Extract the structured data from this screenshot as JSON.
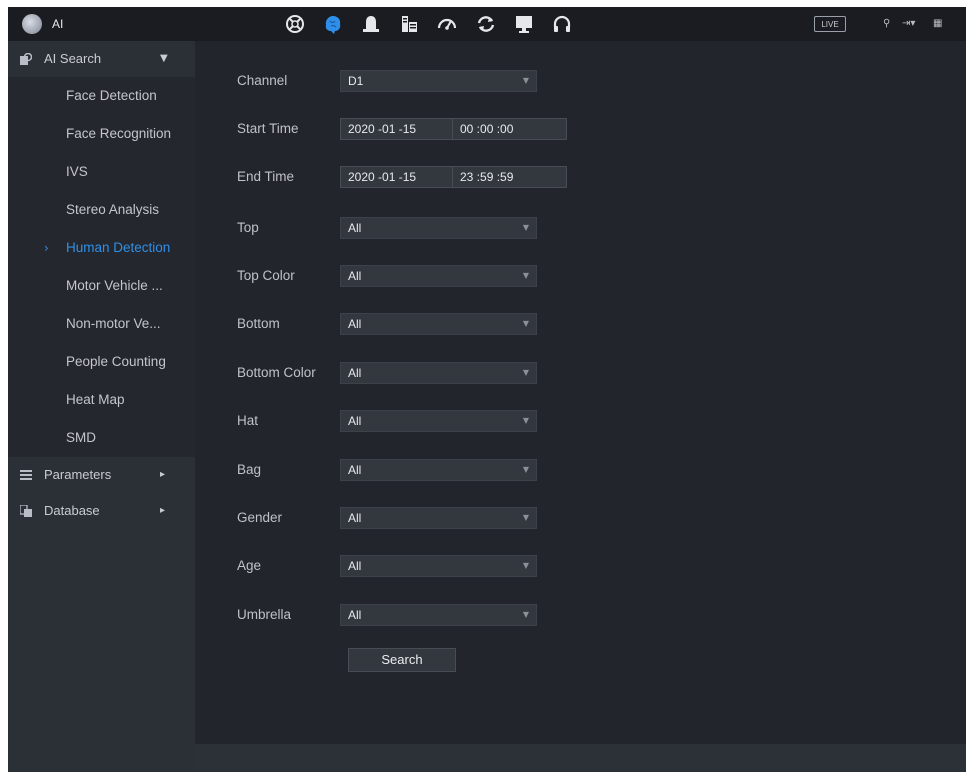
{
  "app": {
    "title": "AI",
    "live_label": "LIVE",
    "top_icons": [
      "network-icon",
      "ai-brain-icon",
      "alarm-bell-icon",
      "storage-icon",
      "speedometer-icon",
      "refresh-icon",
      "monitor-icon",
      "headset-icon"
    ],
    "top_right_icons": [
      "user-icon",
      "logout-icon",
      "grid-icon"
    ]
  },
  "sidebar": {
    "ai_search": {
      "label": "AI Search",
      "icon": "search-icon"
    },
    "items": [
      {
        "label": "Face Detection"
      },
      {
        "label": "Face Recognition"
      },
      {
        "label": "IVS"
      },
      {
        "label": "Stereo Analysis"
      },
      {
        "label": "Human Detection",
        "active": true
      },
      {
        "label": "Motor Vehicle ..."
      },
      {
        "label": "Non-motor Ve..."
      },
      {
        "label": "People Counting"
      },
      {
        "label": "Heat Map"
      },
      {
        "label": "SMD"
      }
    ],
    "parameters": {
      "label": "Parameters",
      "icon": "list-icon"
    },
    "database": {
      "label": "Database",
      "icon": "database-icon"
    },
    "accent_color": "#2f8fe8"
  },
  "form": {
    "channel": {
      "label": "Channel",
      "value": "D1"
    },
    "start_time": {
      "label": "Start Time",
      "date": "2020 -01 -15",
      "time": "00 :00 :00"
    },
    "end_time": {
      "label": "End Time",
      "date": "2020 -01 -15",
      "time": "23 :59 :59"
    },
    "fields": [
      {
        "label": "Top",
        "value": "All"
      },
      {
        "label": "Top Color",
        "value": "All"
      },
      {
        "label": "Bottom",
        "value": "All"
      },
      {
        "label": "Bottom Color",
        "value": "All"
      },
      {
        "label": "Hat",
        "value": "All"
      },
      {
        "label": "Bag",
        "value": "All"
      },
      {
        "label": "Gender",
        "value": "All"
      },
      {
        "label": "Age",
        "value": "All"
      },
      {
        "label": "Umbrella",
        "value": "All"
      }
    ],
    "search_label": "Search"
  }
}
